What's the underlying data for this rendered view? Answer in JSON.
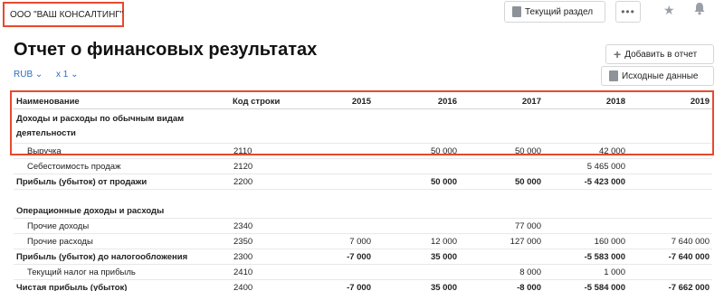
{
  "company": "ООО \"ВАШ КОНСАЛТИНГ\"",
  "toolbar": {
    "section_label": "Текущий раздел",
    "more_label": "•••",
    "star_glyph": "★",
    "bell_glyph": "🔔"
  },
  "title": "Отчет о финансовых результатах",
  "currency": "RUB ⌄",
  "scale": "x 1 ⌄",
  "actions": {
    "add_label": "Добавить в отчет",
    "source_label": "Исходные данные"
  },
  "table": {
    "headers": {
      "name": "Наименование",
      "code": "Код строки",
      "y2015": "2015",
      "y2016": "2016",
      "y2017": "2017",
      "y2018": "2018",
      "y2019": "2019"
    },
    "rows": [
      {
        "name": "Доходы и расходы по обычным видам деятельности",
        "code": "",
        "v": [
          "",
          "",
          "",
          "",
          ""
        ]
      },
      {
        "name": "Выручка",
        "code": "2110",
        "v": [
          "",
          "50 000",
          "50 000",
          "42 000",
          ""
        ]
      },
      {
        "name": "Себестоимость продаж",
        "code": "2120",
        "v": [
          "",
          "",
          "",
          "5 465 000",
          ""
        ]
      },
      {
        "name": "Прибыль (убыток) от продажи",
        "code": "2200",
        "v": [
          "",
          "50 000",
          "50 000",
          "-5 423 000",
          ""
        ]
      },
      {
        "name": "Операционные доходы и расходы",
        "code": "",
        "v": [
          "",
          "",
          "",
          "",
          ""
        ]
      },
      {
        "name": "Прочие доходы",
        "code": "2340",
        "v": [
          "",
          "",
          "77 000",
          "",
          ""
        ]
      },
      {
        "name": "Прочие расходы",
        "code": "2350",
        "v": [
          "7 000",
          "12 000",
          "127 000",
          "160 000",
          "7 640 000"
        ]
      },
      {
        "name": "Прибыль (убыток) до налогообложения",
        "code": "2300",
        "v": [
          "-7 000",
          "35 000",
          "",
          "-5 583 000",
          "-7 640 000"
        ]
      },
      {
        "name": "Текущий налог на прибыль",
        "code": "2410",
        "v": [
          "",
          "",
          "8 000",
          "1 000",
          ""
        ]
      },
      {
        "name": "Чистая прибыль (убыток)",
        "code": "2400",
        "v": [
          "-7 000",
          "35 000",
          "-8 000",
          "-5 584 000",
          "-7 662 000"
        ]
      }
    ]
  }
}
